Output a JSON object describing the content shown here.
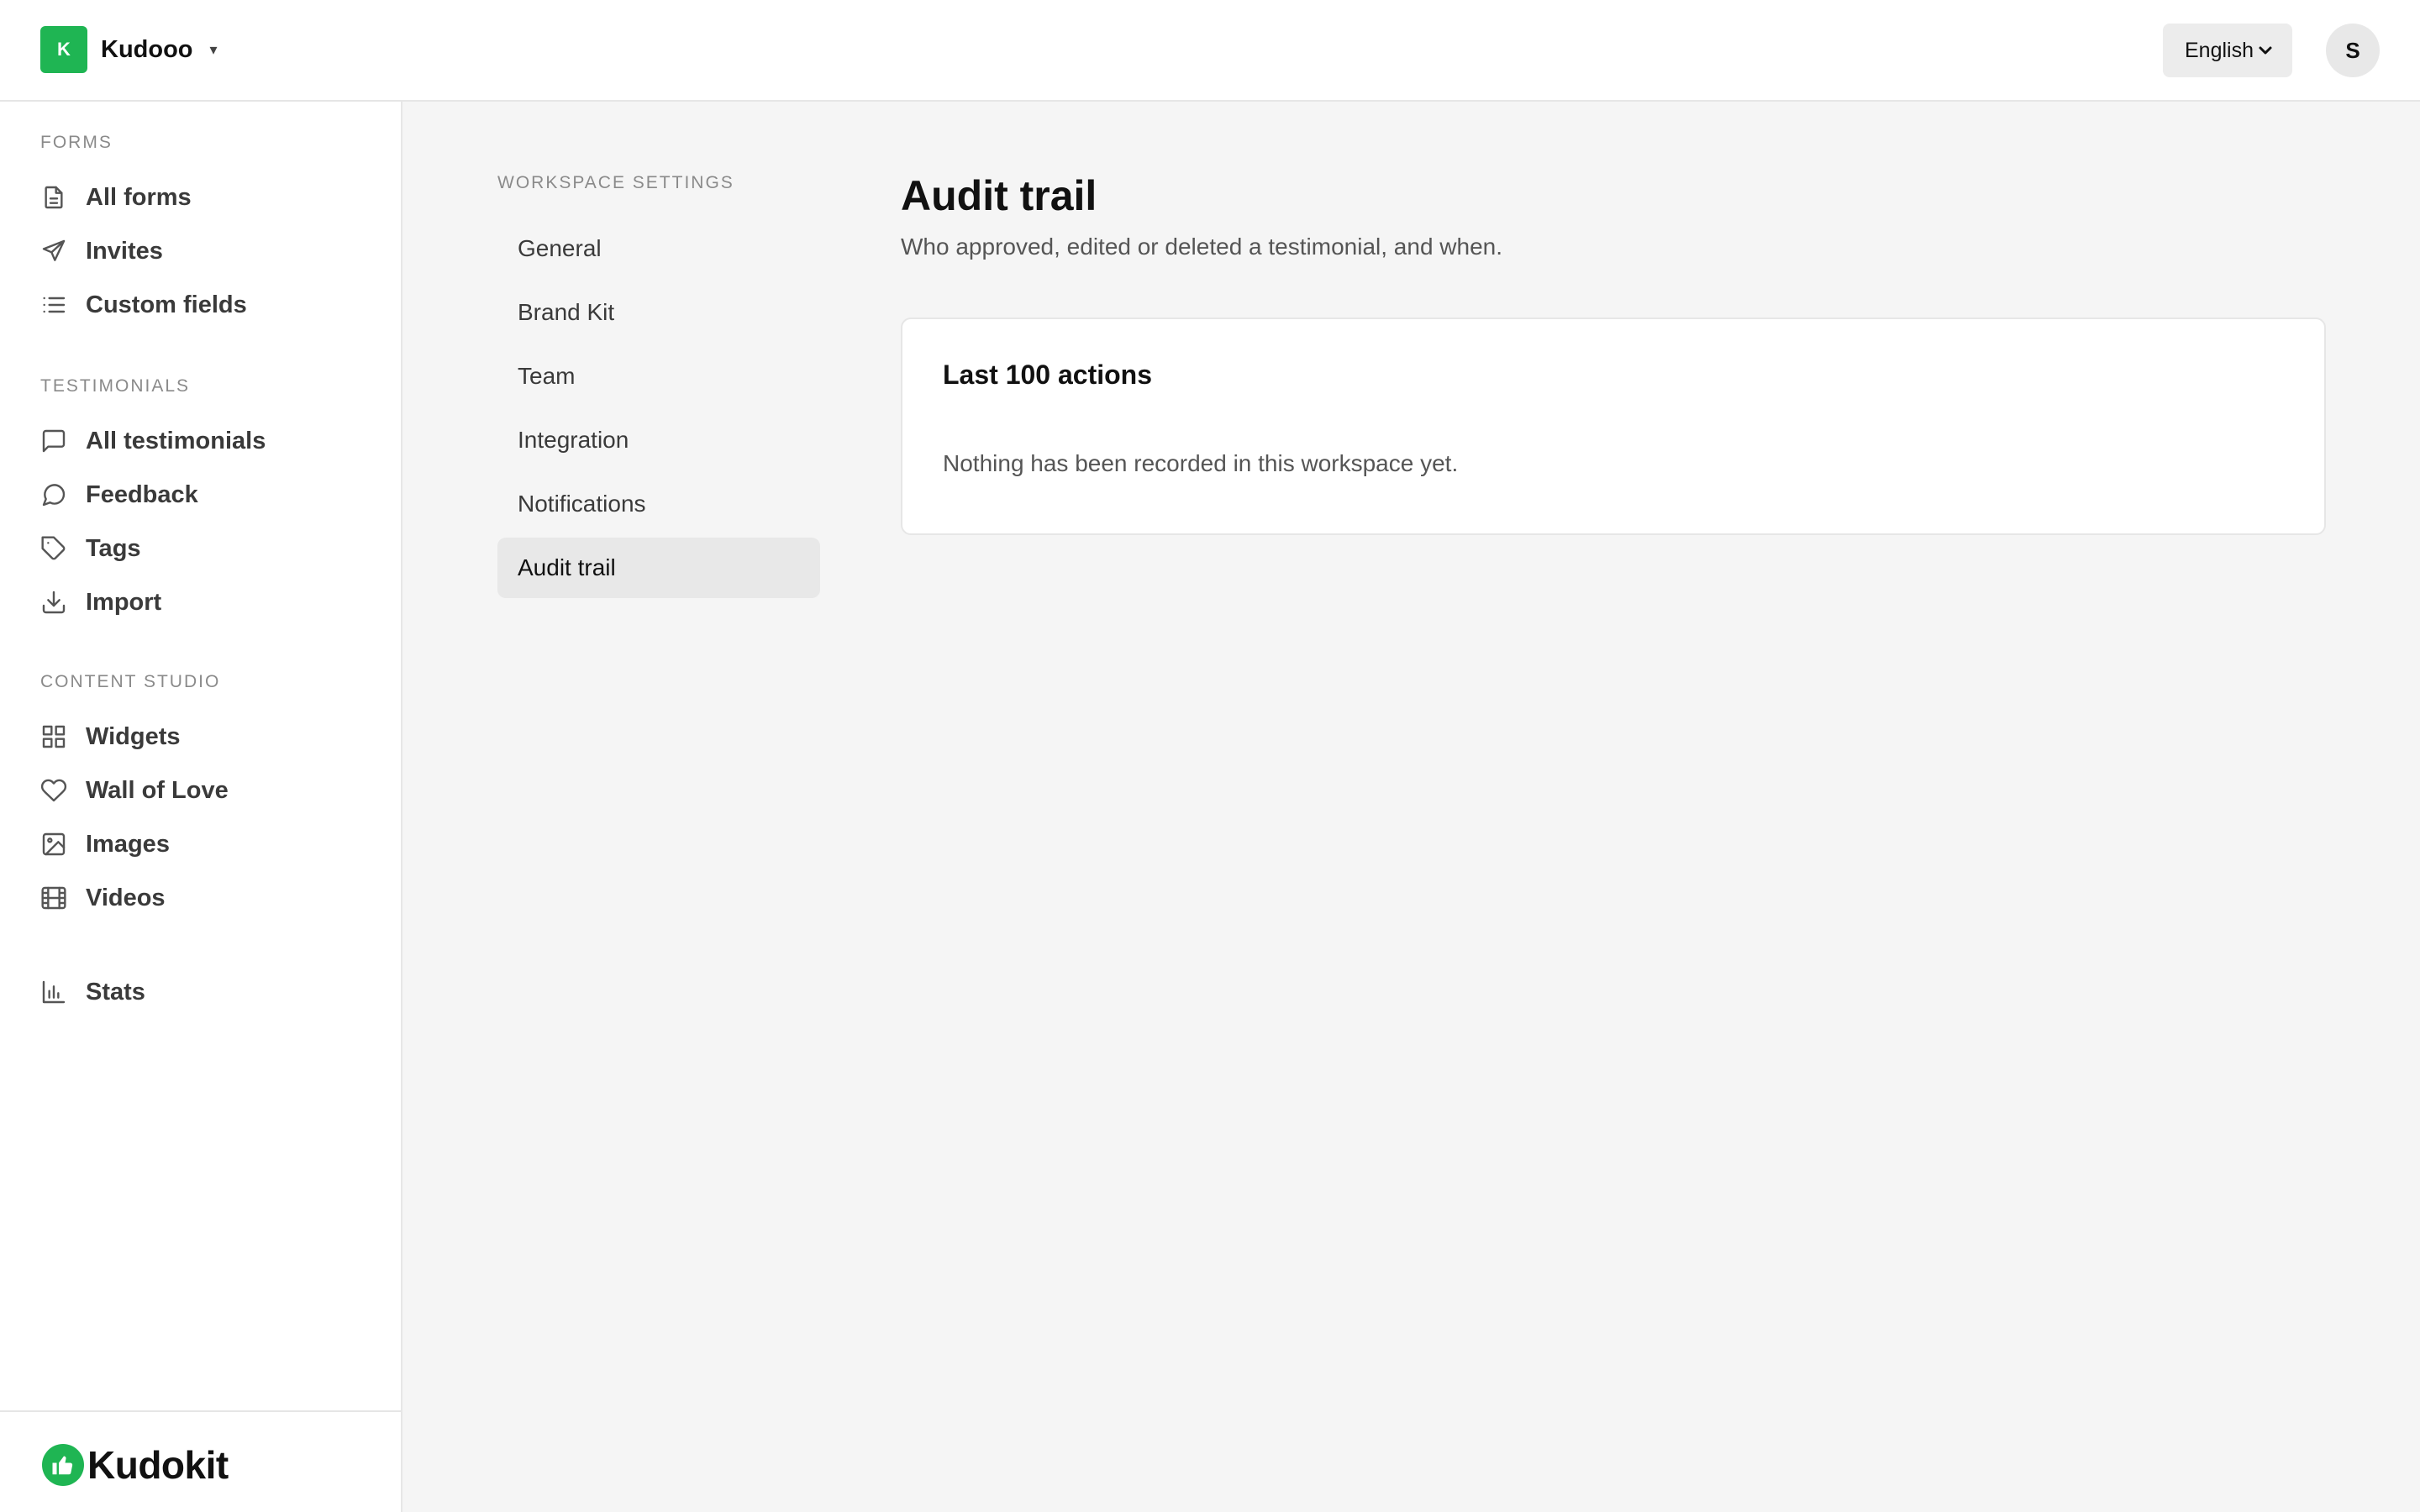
{
  "workspace": {
    "initial": "K",
    "name": "Kudooo",
    "caret": "▾"
  },
  "language": {
    "selected": "English"
  },
  "user": {
    "initial": "S"
  },
  "sidebar": {
    "sections": [
      {
        "title": "FORMS",
        "items": [
          {
            "label": "All forms",
            "icon": "document-icon"
          },
          {
            "label": "Invites",
            "icon": "send-icon"
          },
          {
            "label": "Custom fields",
            "icon": "list-icon"
          }
        ]
      },
      {
        "title": "TESTIMONIALS",
        "items": [
          {
            "label": "All testimonials",
            "icon": "message-square-icon"
          },
          {
            "label": "Feedback",
            "icon": "message-circle-icon"
          },
          {
            "label": "Tags",
            "icon": "tag-icon"
          },
          {
            "label": "Import",
            "icon": "download-icon"
          }
        ]
      },
      {
        "title": "CONTENT STUDIO",
        "items": [
          {
            "label": "Widgets",
            "icon": "grid-icon"
          },
          {
            "label": "Wall of Love",
            "icon": "heart-icon"
          },
          {
            "label": "Images",
            "icon": "image-icon"
          },
          {
            "label": "Videos",
            "icon": "film-icon"
          }
        ]
      }
    ],
    "stats": {
      "label": "Stats",
      "icon": "bar-chart-icon"
    },
    "brand": "Kudokit"
  },
  "settings": {
    "title": "WORKSPACE SETTINGS",
    "items": [
      "General",
      "Brand Kit",
      "Team",
      "Integration",
      "Notifications",
      "Audit trail"
    ],
    "active": "Audit trail"
  },
  "main": {
    "title": "Audit trail",
    "subtitle": "Who approved, edited or deleted a testimonial, and when.",
    "card": {
      "title": "Last 100 actions",
      "empty": "Nothing has been recorded in this workspace yet."
    }
  },
  "colors": {
    "brand": "#1fb553",
    "active_bg": "#e8e8e8",
    "page_bg": "#f5f5f5"
  }
}
